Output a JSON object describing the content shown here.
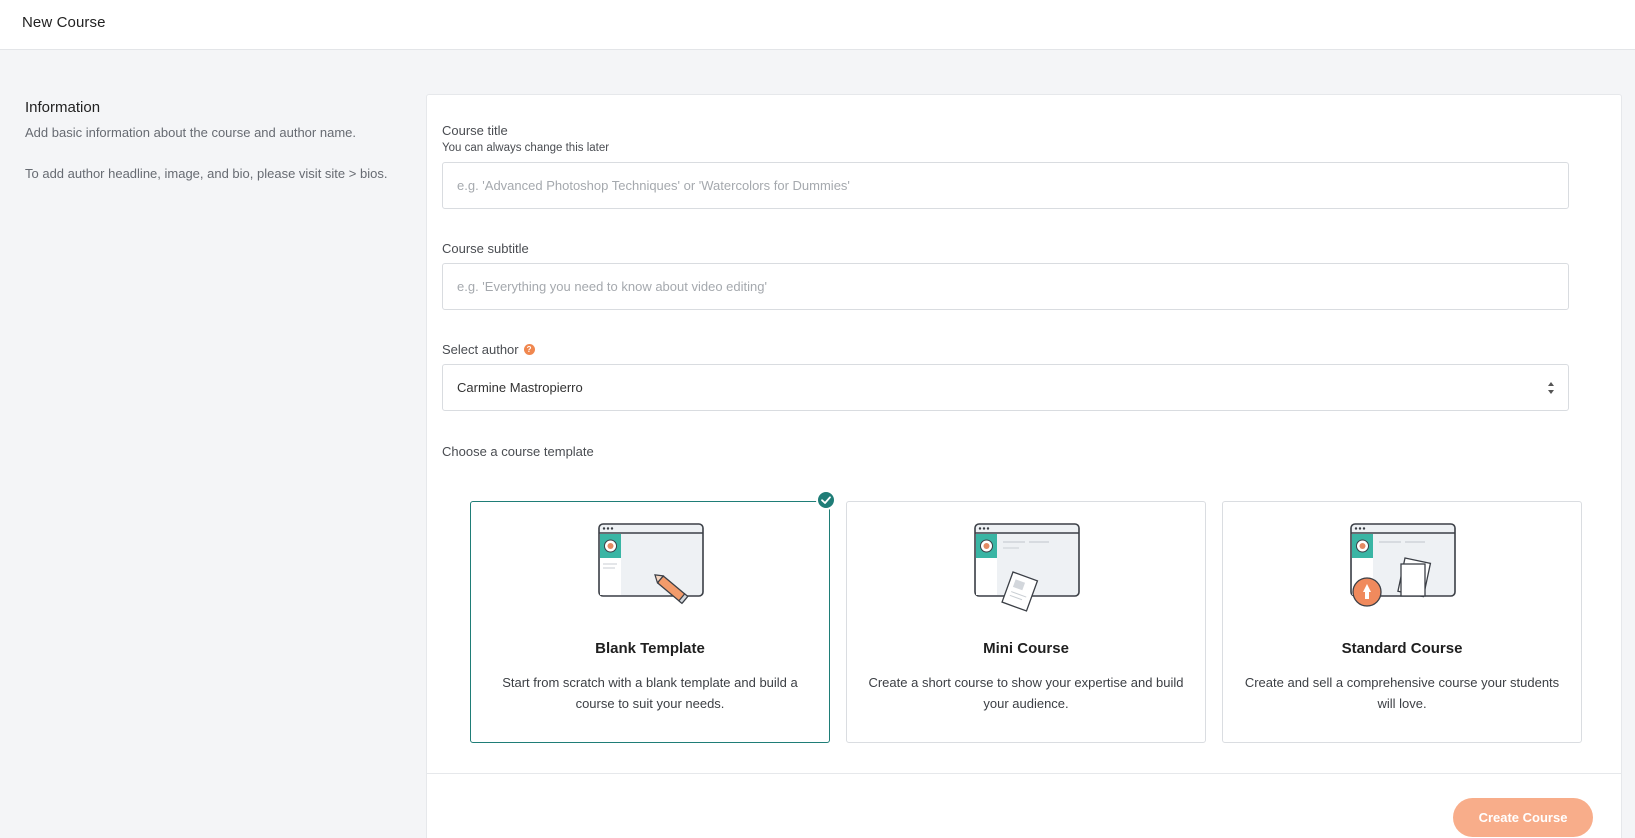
{
  "header": {
    "title": "New Course"
  },
  "sidebar": {
    "heading": "Information",
    "description": "Add basic information about the course and author name.",
    "note": "To add author headline, image, and bio, please visit site > bios."
  },
  "form": {
    "course_title": {
      "label": "Course title",
      "hint": "You can always change this later",
      "placeholder": "e.g. 'Advanced Photoshop Techniques' or 'Watercolors for Dummies'",
      "value": ""
    },
    "course_subtitle": {
      "label": "Course subtitle",
      "placeholder": "e.g. 'Everything you need to know about video editing'",
      "value": ""
    },
    "author": {
      "label": "Select author",
      "help_icon": "?",
      "selected": "Carmine Mastropierro"
    },
    "template_section_label": "Choose a course template",
    "templates": [
      {
        "title": "Blank Template",
        "description": "Start from scratch with a blank template and build a course to suit your needs.",
        "icon": "blank-template-illustration",
        "selected": true
      },
      {
        "title": "Mini Course",
        "description": "Create a short course to show your expertise and build your audience.",
        "icon": "mini-course-illustration",
        "selected": false
      },
      {
        "title": "Standard Course",
        "description": "Create and sell a comprehensive course your students will love.",
        "icon": "standard-course-illustration",
        "selected": false
      }
    ],
    "submit_label": "Create Course"
  },
  "colors": {
    "accent_teal": "#1f7d77",
    "illustration_teal": "#39b5a4",
    "orange": "#f0874f",
    "button_disabled": "#f8ad8a",
    "background": "#f4f5f7"
  }
}
